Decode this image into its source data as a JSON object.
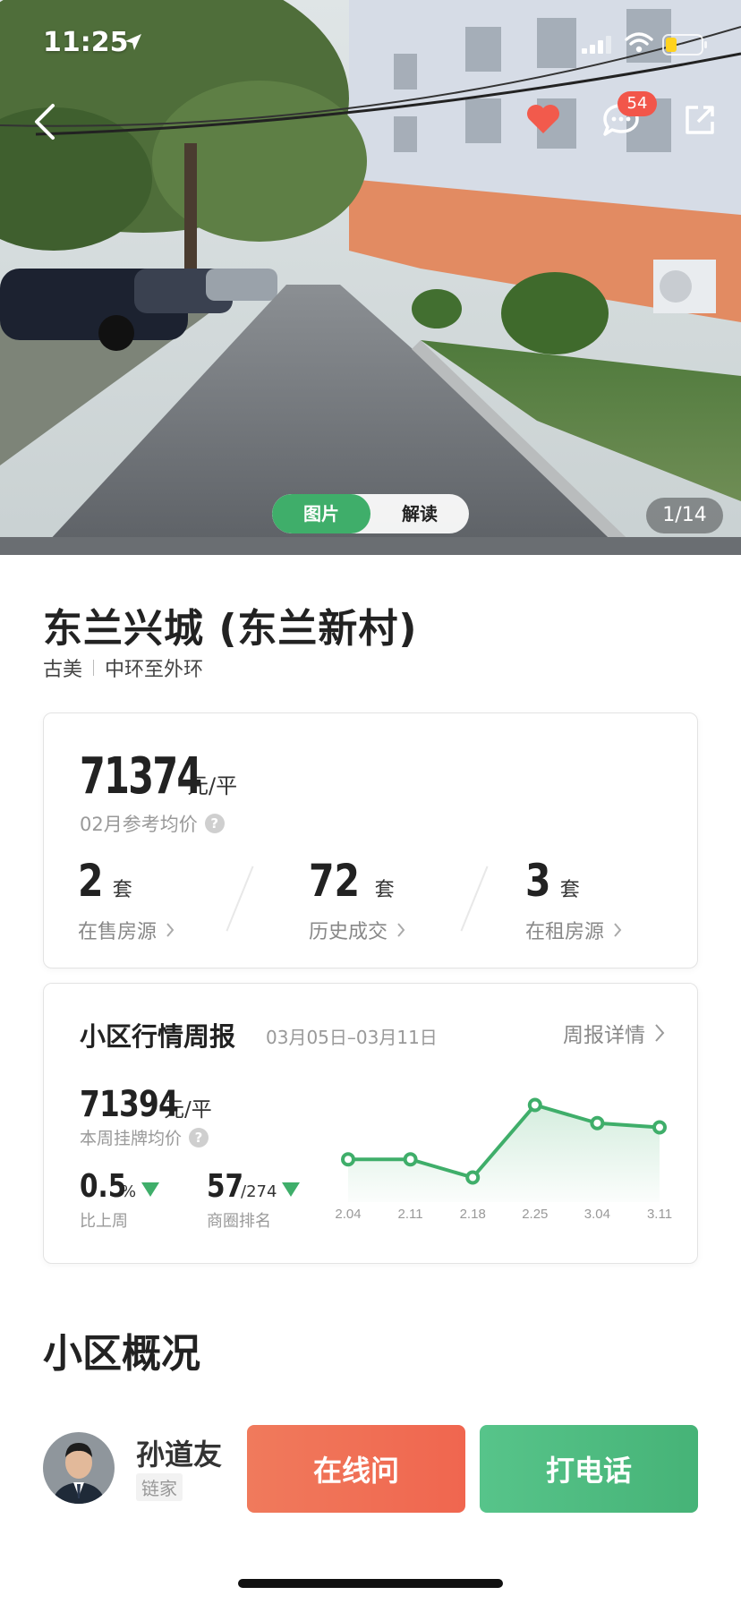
{
  "status_bar": {
    "time": "11:25"
  },
  "hero": {
    "message_badge": "54",
    "tabs": [
      {
        "label": "图片",
        "active": true
      },
      {
        "label": "解读",
        "active": false
      }
    ],
    "photo_counter": "1/14"
  },
  "community": {
    "title": "东兰兴城 (东兰新村)",
    "district": "古美",
    "ring": "中环至外环"
  },
  "price_card": {
    "avg_price": "71374",
    "avg_price_unit": "元/平",
    "avg_price_label": "02月参考均价",
    "help_icon": "?",
    "stats": [
      {
        "value": "2",
        "unit": "套",
        "label": "在售房源"
      },
      {
        "value": "72",
        "unit": "套",
        "label": "历史成交"
      },
      {
        "value": "3",
        "unit": "套",
        "label": "在租房源"
      }
    ]
  },
  "weekly_report": {
    "title": "小区行情周报",
    "date_range": "03月05日–03月11日",
    "detail_link": "周报详情",
    "listing_price": "71394",
    "listing_price_unit": "元/平",
    "listing_price_label": "本周挂牌均价",
    "change_value": "0.5",
    "change_unit": "%",
    "change_label": "比上周",
    "rank_value": "57",
    "rank_total": "/274",
    "rank_label": "商圈排名",
    "colors": {
      "line": "#3fae6a",
      "down_arrow": "#3fae6a"
    }
  },
  "chart_data": {
    "type": "line",
    "categories": [
      "2.04",
      "2.11",
      "2.18",
      "2.25",
      "3.04",
      "3.11"
    ],
    "values": [
      70800,
      70800,
      70500,
      71700,
      71400,
      71330
    ],
    "ylim": [
      70300,
      71900
    ],
    "title": "",
    "xlabel": "",
    "ylabel": "",
    "grid": false
  },
  "overview": {
    "title": "小区概况"
  },
  "agent": {
    "name": "孙道友",
    "company": "链家",
    "ask_label": "在线问",
    "call_label": "打电话"
  }
}
